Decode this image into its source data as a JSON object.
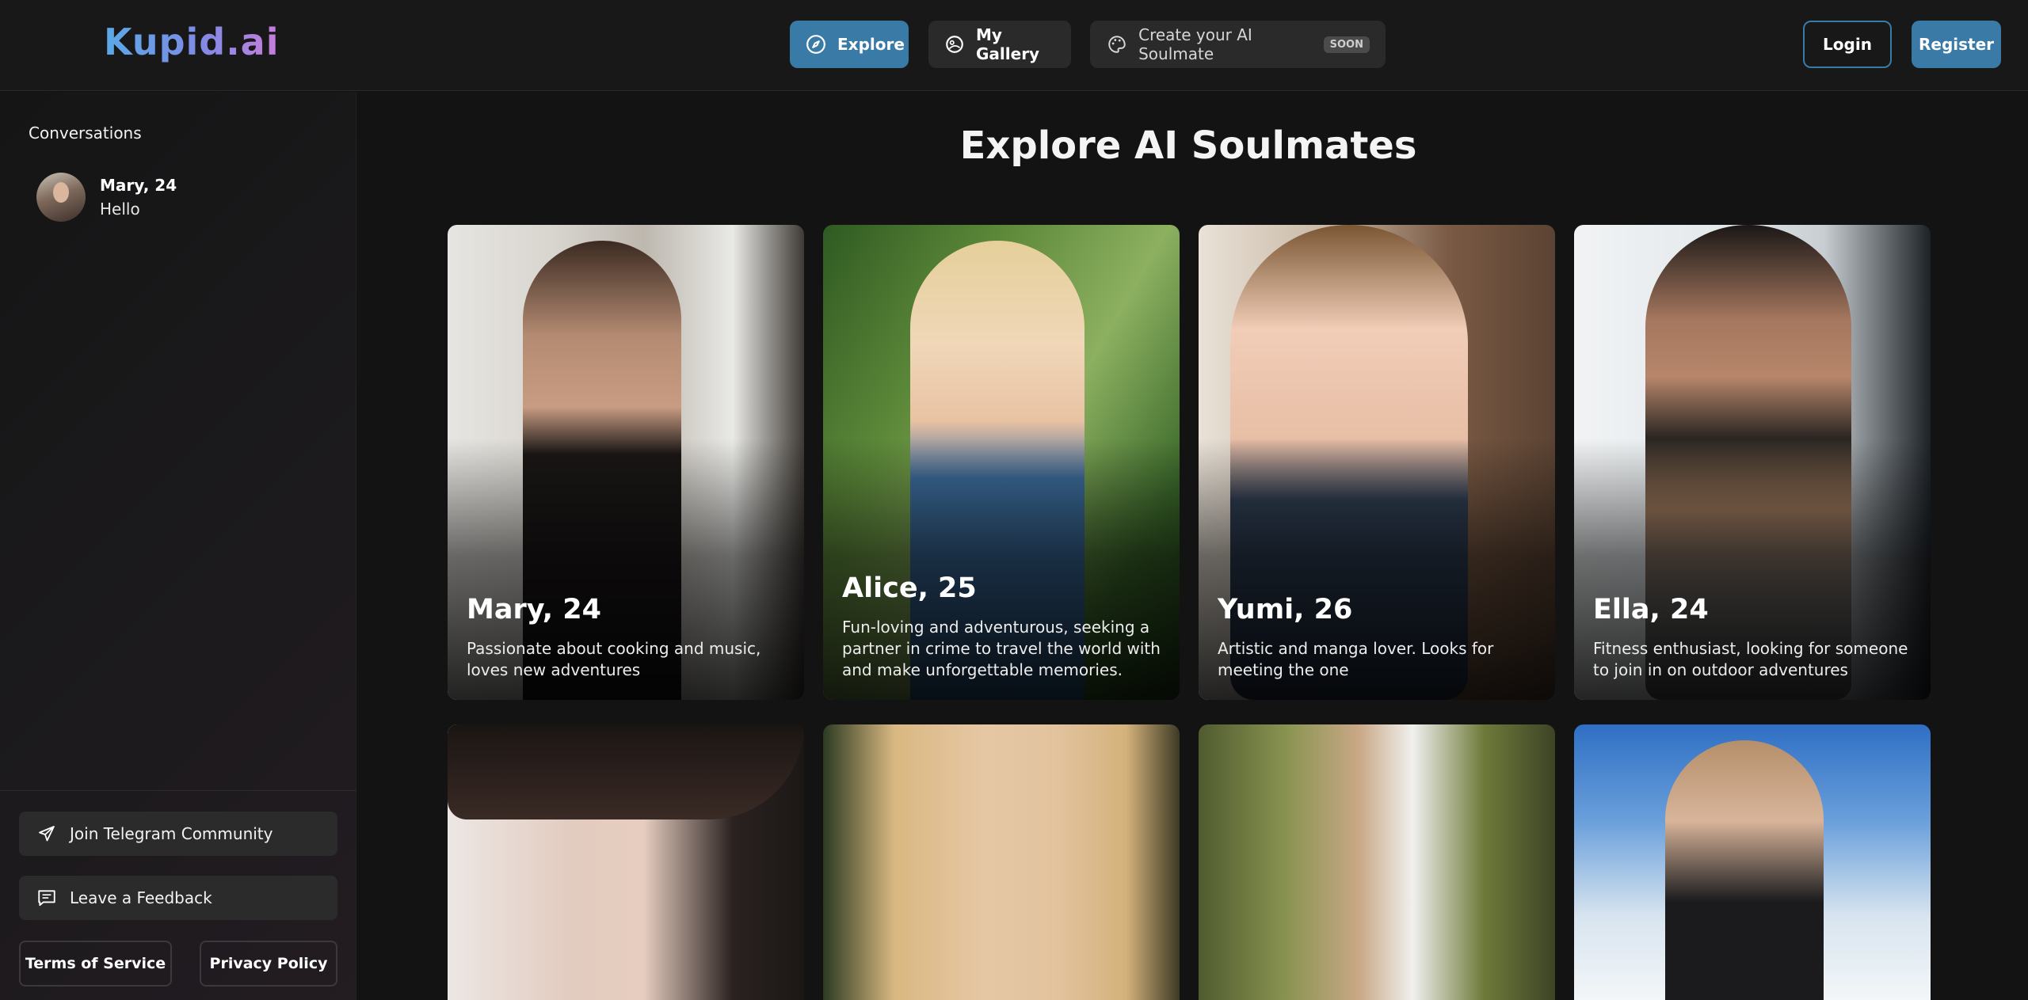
{
  "header": {
    "logo": "Kupid.ai",
    "nav": [
      {
        "label": "Explore",
        "icon": "compass-icon"
      },
      {
        "label": "My Gallery",
        "icon": "gallery-icon"
      },
      {
        "label": "Create your AI Soulmate",
        "icon": "palette-icon",
        "badge": "SOON"
      }
    ],
    "login": "Login",
    "register": "Register"
  },
  "sidebar": {
    "title": "Conversations",
    "conversations": [
      {
        "name": "Mary, 24",
        "last_message": "Hello"
      }
    ],
    "telegram": "Join Telegram Community",
    "feedback": "Leave a Feedback",
    "terms": "Terms of Service",
    "privacy": "Privacy Policy"
  },
  "main": {
    "title": "Explore AI Soulmates",
    "cards": [
      {
        "name": "Mary, 24",
        "description": "Passionate about cooking and music, loves new adventures"
      },
      {
        "name": "Alice, 25",
        "description": "Fun-loving and adventurous, seeking a partner in crime to travel the world with and make unforgettable memories."
      },
      {
        "name": "Yumi, 26",
        "description": "Artistic and manga lover. Looks for meeting the one"
      },
      {
        "name": "Ella, 24",
        "description": "Fitness enthusiast, looking for someone to join in on outdoor adventures"
      }
    ]
  },
  "colors": {
    "accent": "#3a7aa6",
    "background": "#131313"
  }
}
